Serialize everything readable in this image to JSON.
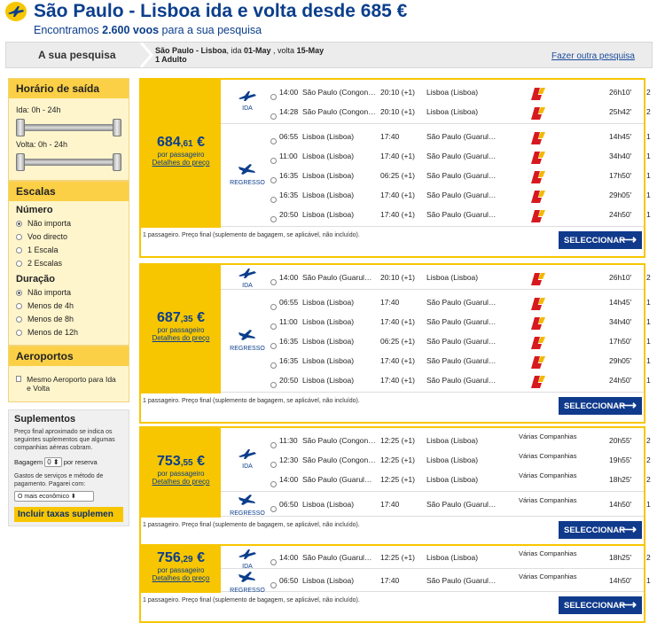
{
  "header": {
    "title": "São Paulo - Lisboa ida e volta desde 685 €",
    "subtitle_pre": "Encontramos ",
    "subtitle_count": "2.600 voos",
    "subtitle_post": " para a sua pesquisa"
  },
  "searchbar": {
    "label": "A sua pesquisa",
    "route": "São Paulo - Lisboa",
    "ida_lbl": ", ida ",
    "ida_date": "01-May",
    "volta_lbl": " , volta ",
    "volta_date": "15-May",
    "pax": "1 Adulto",
    "new_search": "Fazer outra pesquisa"
  },
  "sidebar": {
    "horario": {
      "title": "Horário de saída",
      "ida": "Ida:  0h - 24h",
      "volta": "Volta:  0h - 24h"
    },
    "escalas": {
      "title": "Escalas",
      "numero": "Número",
      "numero_opts": [
        "Não importa",
        "Voo directo",
        "1 Escala",
        "2 Escalas"
      ],
      "duracao": "Duração",
      "duracao_opts": [
        "Não importa",
        "Menos de 4h",
        "Menos de 8h",
        "Menos de 12h"
      ]
    },
    "aeroportos": {
      "title": "Aeroportos",
      "same": "Mesmo Aeroporto para Ida e Volta"
    },
    "suplementos": {
      "title": "Suplementos",
      "desc": "Preço final aproximado se indica os seguintes suplementos que algumas companhias aéreas cobram.",
      "bagagem": "Bagagem",
      "bag_val": "0",
      "por_reserva": "por reserva",
      "gastos": "Gastos de serviços e método de pagamento. Pagarei com:",
      "pay_val": "O mais econômico",
      "incluir": "Incluir taxas suplemen"
    }
  },
  "labels": {
    "ida": "IDA",
    "regresso": "REGRESSO",
    "por_passageiro": "por passageiro",
    "detalhes": "Detalhes do preço",
    "footnote": "1 passageiro. Preço final (suplemento de bagagem, se aplicável, não incluído).",
    "select": "SELECCIONAR",
    "arrow": "⟶",
    "info": "i",
    "currency": "€"
  },
  "results": [
    {
      "price_int": "684",
      "price_dec": ",61",
      "ida": [
        {
          "dep": "14:00",
          "from": "São Paulo (Congon…",
          "arr": "20:10 (+1)",
          "to": "Lisboa (Lisboa)",
          "al": "",
          "dur": "26h10'",
          "stops": "2"
        },
        {
          "dep": "14:28",
          "from": "São Paulo (Congon…",
          "arr": "20:10 (+1)",
          "to": "Lisboa (Lisboa)",
          "al": "",
          "dur": "25h42'",
          "stops": "2"
        }
      ],
      "volta": [
        {
          "dep": "06:55",
          "from": "Lisboa (Lisboa)",
          "arr": "17:40",
          "to": "São Paulo (Guarul…",
          "al": "",
          "dur": "14h45'",
          "stops": "1"
        },
        {
          "dep": "11:00",
          "from": "Lisboa (Lisboa)",
          "arr": "17:40 (+1)",
          "to": "São Paulo (Guarul…",
          "al": "",
          "dur": "34h40'",
          "stops": "1"
        },
        {
          "dep": "16:35",
          "from": "Lisboa (Lisboa)",
          "arr": "06:25 (+1)",
          "to": "São Paulo (Guarul…",
          "al": "",
          "dur": "17h50'",
          "stops": "1"
        },
        {
          "dep": "16:35",
          "from": "Lisboa (Lisboa)",
          "arr": "17:40 (+1)",
          "to": "São Paulo (Guarul…",
          "al": "",
          "dur": "29h05'",
          "stops": "1"
        },
        {
          "dep": "20:50",
          "from": "Lisboa (Lisboa)",
          "arr": "17:40 (+1)",
          "to": "São Paulo (Guarul…",
          "al": "",
          "dur": "24h50'",
          "stops": "1"
        }
      ]
    },
    {
      "price_int": "687",
      "price_dec": ",35",
      "ida": [
        {
          "dep": "14:00",
          "from": "São Paulo (Guarul…",
          "arr": "20:10 (+1)",
          "to": "Lisboa (Lisboa)",
          "al": "",
          "dur": "26h10'",
          "stops": "2"
        }
      ],
      "volta": [
        {
          "dep": "06:55",
          "from": "Lisboa (Lisboa)",
          "arr": "17:40",
          "to": "São Paulo (Guarul…",
          "al": "",
          "dur": "14h45'",
          "stops": "1"
        },
        {
          "dep": "11:00",
          "from": "Lisboa (Lisboa)",
          "arr": "17:40 (+1)",
          "to": "São Paulo (Guarul…",
          "al": "",
          "dur": "34h40'",
          "stops": "1"
        },
        {
          "dep": "16:35",
          "from": "Lisboa (Lisboa)",
          "arr": "06:25 (+1)",
          "to": "São Paulo (Guarul…",
          "al": "",
          "dur": "17h50'",
          "stops": "1"
        },
        {
          "dep": "16:35",
          "from": "Lisboa (Lisboa)",
          "arr": "17:40 (+1)",
          "to": "São Paulo (Guarul…",
          "al": "",
          "dur": "29h05'",
          "stops": "1"
        },
        {
          "dep": "20:50",
          "from": "Lisboa (Lisboa)",
          "arr": "17:40 (+1)",
          "to": "São Paulo (Guarul…",
          "al": "",
          "dur": "24h50'",
          "stops": "1"
        }
      ]
    },
    {
      "price_int": "753",
      "price_dec": ",55",
      "ida": [
        {
          "dep": "11:30",
          "from": "São Paulo (Congon…",
          "arr": "12:25 (+1)",
          "to": "Lisboa (Lisboa)",
          "al": "Várias Companhias",
          "dur": "20h55'",
          "stops": "2"
        },
        {
          "dep": "12:30",
          "from": "São Paulo (Congon…",
          "arr": "12:25 (+1)",
          "to": "Lisboa (Lisboa)",
          "al": "Várias Companhias",
          "dur": "19h55'",
          "stops": "2"
        },
        {
          "dep": "14:00",
          "from": "São Paulo (Guarul…",
          "arr": "12:25 (+1)",
          "to": "Lisboa (Lisboa)",
          "al": "Várias Companhias",
          "dur": "18h25'",
          "stops": "2"
        }
      ],
      "volta": [
        {
          "dep": "06:50",
          "from": "Lisboa (Lisboa)",
          "arr": "17:40",
          "to": "São Paulo (Guarul…",
          "al": "Várias Companhias",
          "dur": "14h50'",
          "stops": "1"
        }
      ]
    },
    {
      "price_int": "756",
      "price_dec": ",29",
      "ida": [
        {
          "dep": "14:00",
          "from": "São Paulo (Guarul…",
          "arr": "12:25 (+1)",
          "to": "Lisboa (Lisboa)",
          "al": "Várias Companhias",
          "dur": "18h25'",
          "stops": "2"
        }
      ],
      "volta": [
        {
          "dep": "06:50",
          "from": "Lisboa (Lisboa)",
          "arr": "17:40",
          "to": "São Paulo (Guarul…",
          "al": "Várias Companhias",
          "dur": "14h50'",
          "stops": "1"
        }
      ]
    }
  ],
  "colors": {
    "brand_yellow": "#f7c600",
    "brand_blue": "#0b3e8c",
    "button_blue": "#103a8b",
    "iberia_red": "#d7191f",
    "iberia_yellow": "#f5b800"
  }
}
